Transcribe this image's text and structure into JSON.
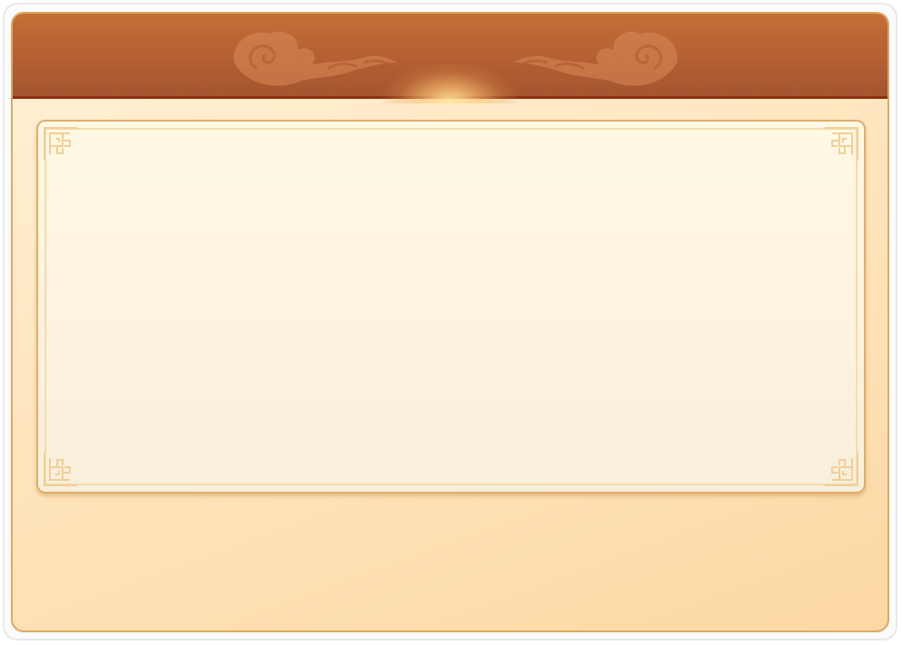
{
  "theme": {
    "header_color": "#b8602f",
    "header_border": "#8f3010",
    "panel_color": "#ffe6bf",
    "card_color": "#fdf5e0",
    "ornament_color": "#f2cf95"
  },
  "header": {
    "title": ""
  },
  "icons": [
    "cloud-ornament-icon",
    "fret-corner-icon"
  ]
}
